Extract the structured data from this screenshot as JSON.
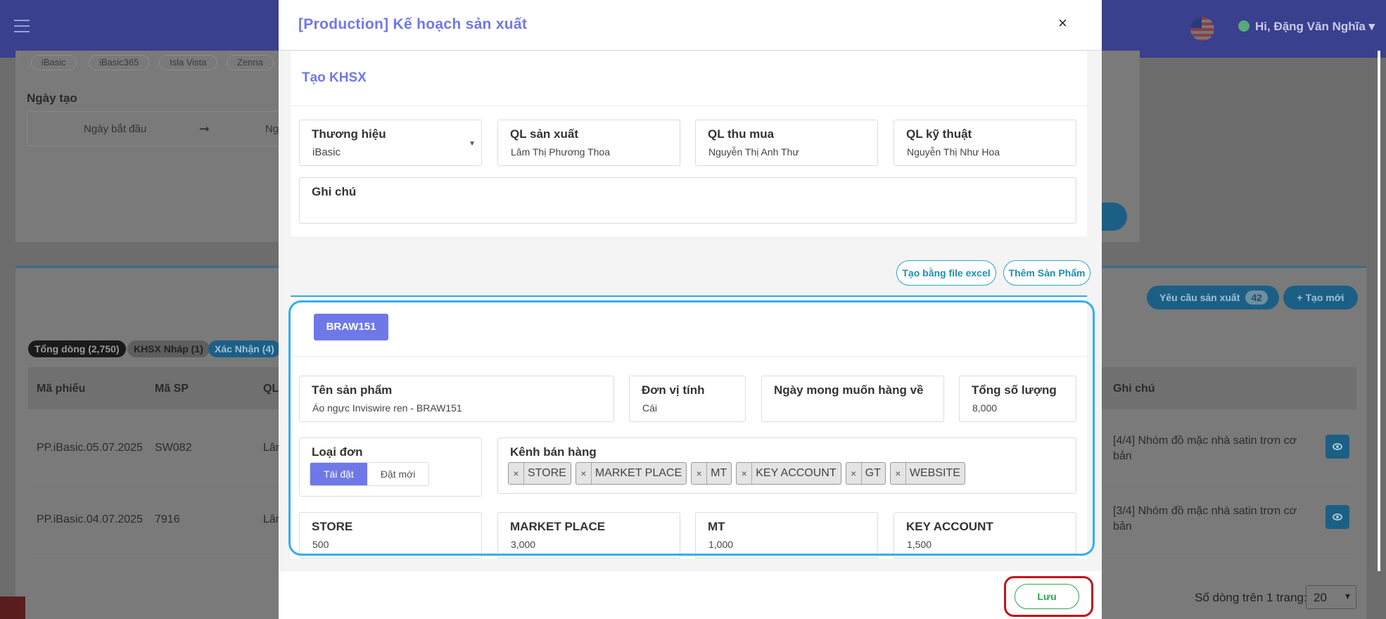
{
  "topbar": {
    "user_greeting": "Hi, Đặng Văn Nghĩa ▾"
  },
  "background": {
    "brand_chips": [
      "iBasic",
      "iBasic365",
      "Isla Vista",
      "Zenna"
    ],
    "ngay_tao_label": "Ngày tạo",
    "date_start_placeholder": "Ngày bắt đầu",
    "date_arrow": "➞",
    "date_end_partial": "Ng",
    "status_chips": [
      "Tổng dòng (2,750)",
      "KHSX Nháp (1)",
      "Xác Nhận (4)"
    ],
    "request_button": "Yêu cầu sản xuất",
    "request_count": "42",
    "new_button": "+ Tạo mới",
    "table_headers": [
      "Mã phiếu",
      "Mã SP",
      "QL",
      "Ghi chú"
    ],
    "rows": [
      {
        "ma_phieu": "PP.iBasic.05.07.2025",
        "ma_sp": "SW082",
        "ql": "Lân",
        "ghi_chu": "[4/4] Nhóm đồ mặc nhà satin trơn cơ bản"
      },
      {
        "ma_phieu": "PP.iBasic.04.07.2025",
        "ma_sp": "7916",
        "ql": "Lân",
        "ghi_chu": "[3/4] Nhóm đồ mặc nhà satin trơn cơ bản"
      }
    ],
    "rows_per_page_label": "Số dòng trên 1 trang:",
    "rows_per_page_value": "20"
  },
  "modal": {
    "title": "[Production] Kế hoạch sản xuất",
    "close": "×",
    "section_title": "Tạo KHSX",
    "fields": {
      "brand": {
        "label": "Thương hiệu",
        "value": "iBasic"
      },
      "ql_san_xuat": {
        "label": "QL sản xuất",
        "value": "Lâm Thị Phương Thoa"
      },
      "ql_thu_mua": {
        "label": "QL thu mua",
        "value": "Nguyễn Thị Anh Thư"
      },
      "ql_ky_thuat": {
        "label": "QL kỹ thuật",
        "value": "Nguyễn Thị Như Hoa"
      },
      "ghi_chu": {
        "label": "Ghi chú",
        "value": ""
      }
    },
    "buttons": {
      "excel": "Tạo bằng file excel",
      "add_product": "Thêm Sản Phẩm",
      "save": "Lưu"
    },
    "product": {
      "code": "BRAW151",
      "name": {
        "label": "Tên sản phẩm",
        "value": "Áo ngực Inviswire ren - BRAW151"
      },
      "unit": {
        "label": "Đơn vị tính",
        "value": "Cái"
      },
      "desired_date": {
        "label": "Ngày mong muốn hàng về",
        "value": ""
      },
      "total_qty": {
        "label": "Tổng số lượng",
        "value": "8,000"
      },
      "order_type": {
        "label": "Loại đơn",
        "options": [
          "Tái đặt",
          "Đặt mới"
        ],
        "selected": "Tái đặt"
      },
      "channels": {
        "label": "Kênh bán hàng",
        "tags": [
          "STORE",
          "MARKET PLACE",
          "MT",
          "KEY ACCOUNT",
          "GT",
          "WEBSITE"
        ]
      },
      "channel_qty": [
        {
          "label": "STORE",
          "value": "500"
        },
        {
          "label": "MARKET PLACE",
          "value": "3,000"
        },
        {
          "label": "MT",
          "value": "1,000"
        },
        {
          "label": "KEY ACCOUNT",
          "value": "1,500"
        }
      ]
    }
  },
  "colors": {
    "accent": "#6f78e8",
    "cyan": "#2fb0ef",
    "save_green": "#2ea44f",
    "highlight_red": "#c4121c"
  }
}
